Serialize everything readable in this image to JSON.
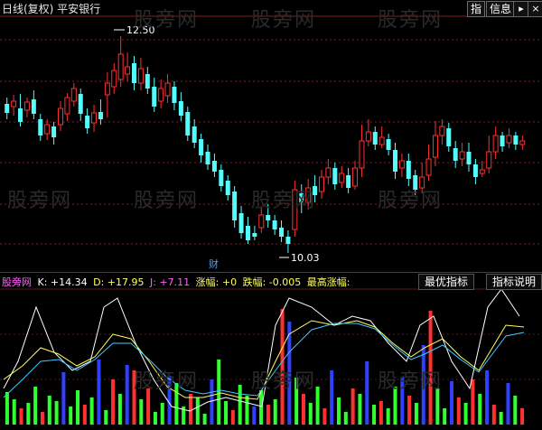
{
  "header": {
    "title": "日线(复权) 平安银行",
    "buttons": [
      {
        "label": "指",
        "name": "index-button"
      },
      {
        "label": "信息",
        "name": "info-button"
      },
      {
        "label": "▸",
        "name": "expand-button"
      },
      {
        "label": "×",
        "name": "close-button"
      }
    ]
  },
  "price": {
    "high_label": "12.50",
    "low_label": "10.03",
    "marker": "财",
    "colors": {
      "up": "#ff3030",
      "down": "#54fcfc",
      "grid": "#8a1c1c"
    }
  },
  "indicator": {
    "name": "股旁网",
    "k_label": "K: +14.34",
    "d_label": "D: +17.95",
    "j_label": "J: +7.11",
    "rise_label": "涨幅: +0",
    "fall_label": "跌幅: -0.005",
    "max_label": "最高涨幅:",
    "tabs": [
      "最优指标",
      "指标说明"
    ],
    "colors": {
      "k": "#ffffff",
      "d": "#ffff60",
      "j": "#ff60ff",
      "rise": "#ffff60",
      "fall": "#ffff60"
    }
  },
  "watermark": "股旁网"
}
